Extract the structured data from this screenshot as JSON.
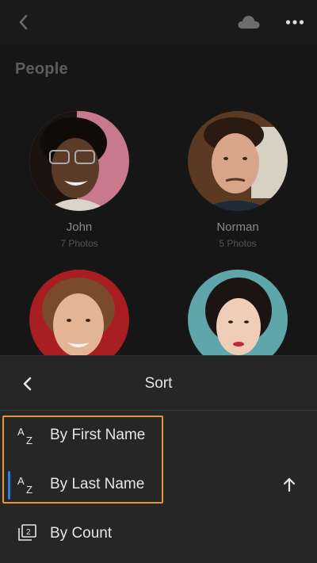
{
  "header": {
    "back_icon": "chevron-left-icon",
    "cloud_icon": "cloud-icon",
    "more_icon": "more-horizontal-icon",
    "title": "People"
  },
  "people": [
    {
      "name": "John",
      "count": "7 Photos",
      "bg_color": "#c87a8c"
    },
    {
      "name": "Norman",
      "count": "5 Photos",
      "bg_color": "#5a3a22"
    },
    {
      "name": "",
      "count": "",
      "bg_color": "#a81e22"
    },
    {
      "name": "",
      "count": "",
      "bg_color": "#5fa6aa"
    }
  ],
  "sort_sheet": {
    "back_icon": "chevron-left-icon",
    "title": "Sort",
    "options": [
      {
        "label": "By First Name",
        "icon": "sort-alpha-icon",
        "selected": false
      },
      {
        "label": "By Last Name",
        "icon": "sort-alpha-icon",
        "selected": true,
        "direction_icon": "arrow-up-icon"
      },
      {
        "label": "By Count",
        "icon": "count-stack-icon",
        "selected": false
      }
    ]
  },
  "colors": {
    "accent": "#2d7de0",
    "highlight": "#e89430"
  }
}
